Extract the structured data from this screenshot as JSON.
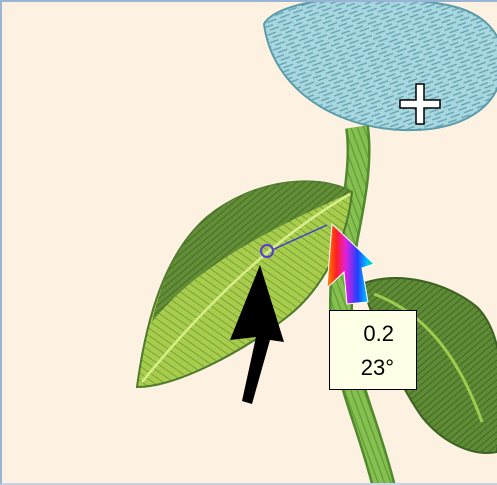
{
  "stitch_tooltip": {
    "length": "0.2",
    "angle": "23°"
  },
  "cursors": {
    "move": "crosshair-move-icon",
    "pointer": "black-arrow-icon",
    "stitch_angle": "rainbow-angle-arrow-icon"
  },
  "colors": {
    "background": "#fdf1e1",
    "leaf_light": "#b8d85a",
    "leaf_dark": "#4f7a2e",
    "stem": "#7ab648",
    "flower": "#a8d6df",
    "flower_dark": "#5b9cac",
    "tooltip_bg": "#fffee6"
  }
}
